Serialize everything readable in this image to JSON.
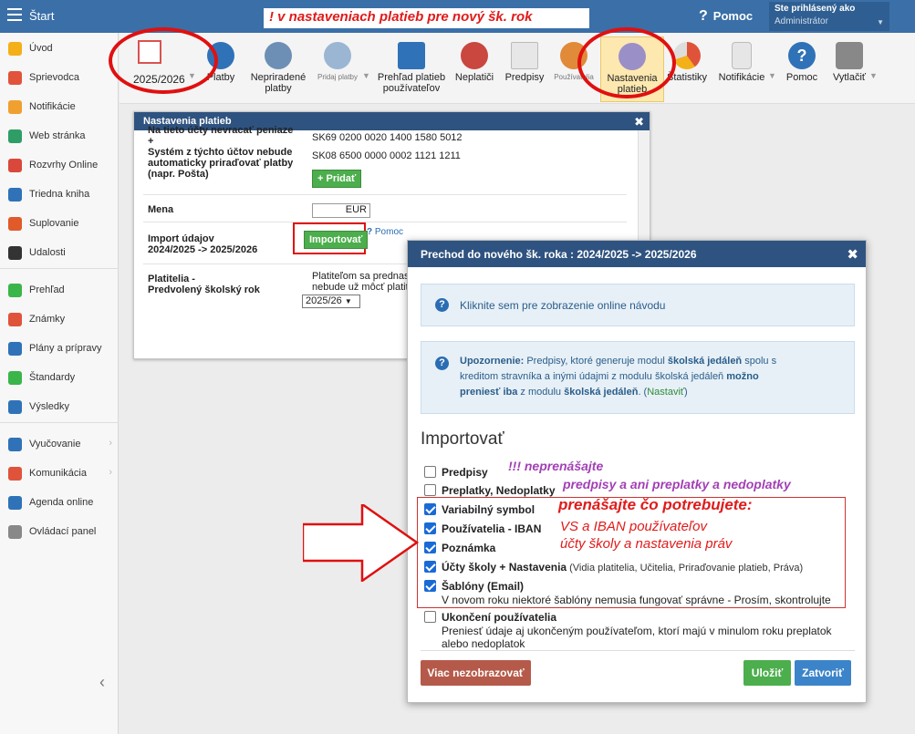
{
  "topbar": {
    "start": "Štart",
    "banner": "! v nastaveniach platieb pre nový šk. rok",
    "help": "Pomoc",
    "user_title": "Ste prihlásený ako",
    "user_role": "Administrátor"
  },
  "sidebar": {
    "items": [
      {
        "label": "Úvod",
        "color": "#f3b019"
      },
      {
        "label": "Sprievodca",
        "color": "#e2533b"
      },
      {
        "label": "Notifikácie",
        "color": "#f0a030"
      },
      {
        "label": "Web stránka",
        "color": "#2e9e66"
      },
      {
        "label": "Rozvrhy Online",
        "color": "#d9483b"
      },
      {
        "label": "Triedna kniha",
        "color": "#2f72b8"
      },
      {
        "label": "Suplovanie",
        "color": "#e05a2a"
      },
      {
        "label": "Udalosti",
        "color": "#333333"
      },
      {
        "label": "Prehľad",
        "color": "#3ab54a"
      },
      {
        "label": "Známky",
        "color": "#e0533b"
      },
      {
        "label": "Plány a prípravy",
        "color": "#2f72b8"
      },
      {
        "label": "Štandardy",
        "color": "#3ab54a"
      },
      {
        "label": "Výsledky",
        "color": "#2f72b8"
      },
      {
        "label": "Vyučovanie",
        "color": "#2f72b8"
      },
      {
        "label": "Komunikácia",
        "color": "#e0533b"
      },
      {
        "label": "Agenda online",
        "color": "#2f72b8"
      },
      {
        "label": "Ovládací panel",
        "color": "#888888"
      }
    ],
    "collapse": "‹"
  },
  "toolbar": {
    "year": "2025/2026",
    "items": [
      {
        "label": "Platby"
      },
      {
        "label": "Nepriradené platby"
      },
      {
        "label": "Pridaj platby"
      },
      {
        "label": "Prehľad platieb používateľov"
      },
      {
        "label": "Neplatiči"
      },
      {
        "label": "Predpisy"
      },
      {
        "label": "Používatelia"
      },
      {
        "label": "Nastavenia platieb"
      },
      {
        "label": "Štatistiky"
      },
      {
        "label": "Notifikácie"
      },
      {
        "label": "Pomoc"
      },
      {
        "label": "Vytlačiť"
      }
    ]
  },
  "panel": {
    "title": "Nastavenia platieb",
    "accounts_label": "Na tieto účty nevracať peniaze + Systém z týchto účtov nebude automaticky priraďovať platby (napr. Pošta)",
    "accounts_label_l1": "Na tieto účty nevracať peniaze",
    "accounts_label_l2": "+",
    "accounts_label_l3": "Systém z týchto účtov nebude",
    "accounts_label_l4": "automaticky priraďovať platby",
    "accounts_label_l5": "(napr. Pošta)",
    "iban1": "SK69 0200 0020 1400 1580 5012",
    "iban2": "SK08 6500 0000 0002 1121 1211",
    "add_btn": "+ Pridať",
    "mena_label": "Mena",
    "mena_value": "EUR",
    "import_label_l1": "Import údajov",
    "import_label_l2": "2024/2025 -> 2025/2026",
    "import_btn": "Importovať",
    "help_link": "Pomoc",
    "platitelia_l1": "Platitelia -",
    "platitelia_l2": "Predvolený školský rok",
    "platitelia_text_l1": "Platiteľom sa prednasta",
    "platitelia_text_l2": "nebude už môcť platiť z",
    "year_select": "2025/26"
  },
  "dialog": {
    "title": "Prechod do nového šk. roka : 2024/2025 -> 2025/2026",
    "info_link": "Kliknite sem pre zobrazenie online návodu",
    "warn_prefix": "Upozornenie:",
    "warn_l1_a": " Predpisy, ktoré generuje modul ",
    "warn_l1_b": "školská jedáleň",
    "warn_l1_c": " spolu s",
    "warn_l2_a": "kreditom stravníka a inými údajmi z modulu školská jedáleň ",
    "warn_l2_b": "možno",
    "warn_l3_a": "preniesť iba",
    "warn_l3_b": " z modulu ",
    "warn_l3_c": "školská jedáleň",
    "warn_l3_d": ". (",
    "warn_l3_e": "Nastaviť",
    "warn_l3_f": ")",
    "import_title": "Importovať",
    "options": [
      {
        "label": "Predpisy",
        "checked": false
      },
      {
        "label": "Preplatky, Nedoplatky",
        "checked": false
      },
      {
        "label": "Variabilný symbol",
        "checked": true
      },
      {
        "label": "Používatelia - IBAN",
        "checked": true
      },
      {
        "label": "Poznámka",
        "checked": true
      },
      {
        "label": "Účty školy + Nastavenia",
        "sub": " (Vidia platitelia, Učitelia, Priraďovanie platieb, Práva)",
        "checked": true
      },
      {
        "label": "Šablóny (Email)",
        "checked": true,
        "note": "V novom roku niektoré šablóny nemusia fungovať správne - Prosím, skontrolujte"
      },
      {
        "label": "Ukončení používatelia",
        "checked": false,
        "note1": "Preniesť údaje aj ukončeným používateľom, ktorí majú v minulom roku preplatok",
        "note2": "alebo nedoplatok"
      }
    ],
    "btn_hide": "Viac nezobrazovať",
    "btn_save": "Uložiť",
    "btn_close": "Zatvoriť"
  },
  "annotations": {
    "purple1": "!!! neprenášajte",
    "purple2": "predpisy a ani preplatky a nedoplatky",
    "red_title": "prenášajte čo potrebujete:",
    "red_l1": "VS a IBAN používateľov",
    "red_l2": "účty školy a nastavenia práv"
  }
}
